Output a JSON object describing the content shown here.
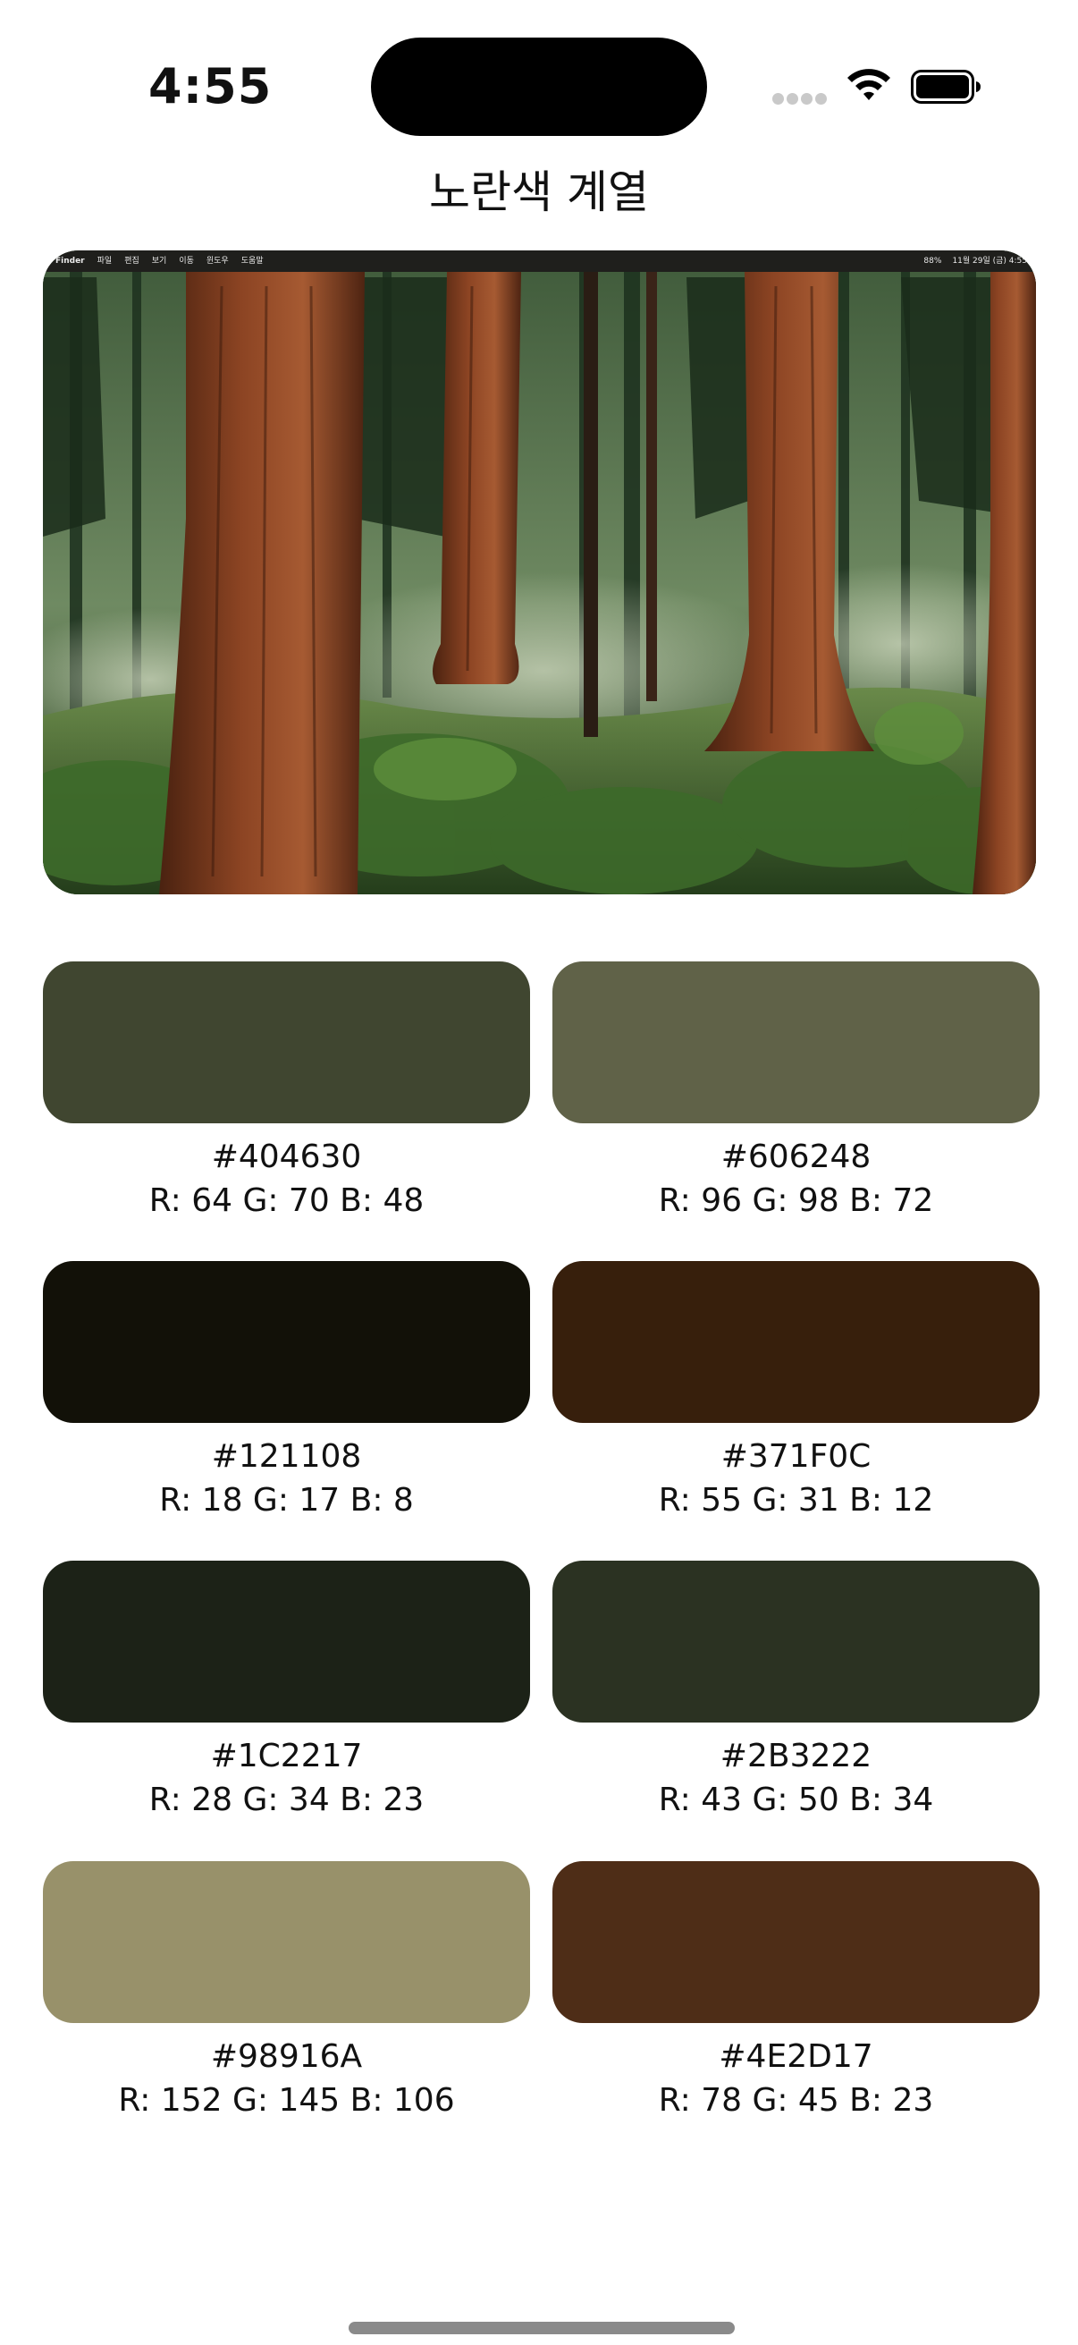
{
  "status_bar": {
    "time": "4:55"
  },
  "header": {
    "title": "노란색 계열"
  },
  "wallpaper": {
    "menubar_left": [
      "Finder",
      "파일",
      "편집",
      "보기",
      "이동",
      "윈도우",
      "도움말"
    ],
    "menubar_right": [
      "88%",
      "11월 29일 (금) 4:55"
    ]
  },
  "swatches": [
    {
      "hex": "#404630",
      "rgb": "R: 64 G: 70 B: 48",
      "color": "#404630"
    },
    {
      "hex": "#606248",
      "rgb": "R: 96 G: 98 B: 72",
      "color": "#606248"
    },
    {
      "hex": "#121108",
      "rgb": "R: 18 G: 17 B: 8",
      "color": "#121108"
    },
    {
      "hex": "#371F0C",
      "rgb": "R: 55 G: 31 B: 12",
      "color": "#371F0C"
    },
    {
      "hex": "#1C2217",
      "rgb": "R: 28 G: 34 B: 23",
      "color": "#1C2217"
    },
    {
      "hex": "#2B3222",
      "rgb": "R: 43 G: 50 B: 34",
      "color": "#2B3222"
    },
    {
      "hex": "#98916A",
      "rgb": "R: 152 G: 145 B: 106",
      "color": "#98916A"
    },
    {
      "hex": "#4E2D17",
      "rgb": "R: 78 G: 45 B: 23",
      "color": "#4E2D17"
    }
  ],
  "icons": {
    "wifi": "wifi-icon",
    "battery": "battery-icon",
    "signal": "cellular-signal-icon"
  }
}
